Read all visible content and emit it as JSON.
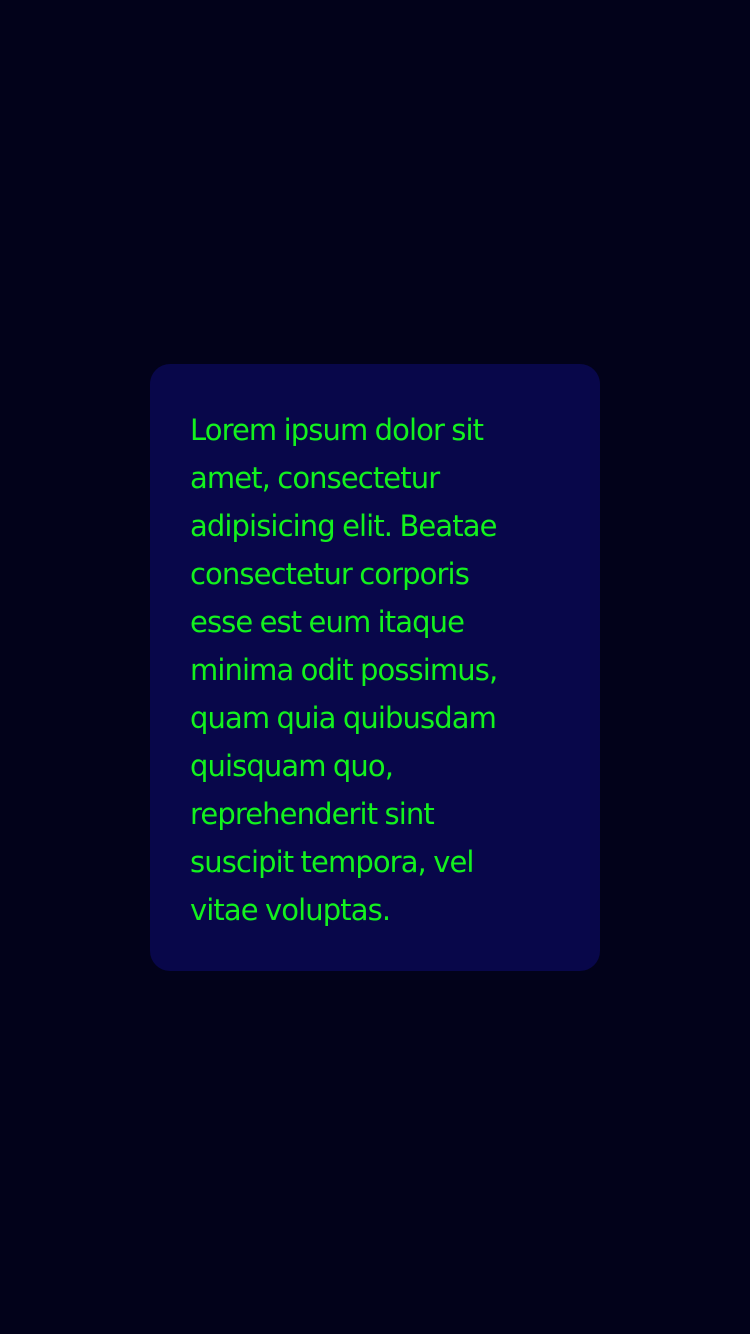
{
  "card": {
    "text": "Lorem ipsum dolor sit\namet, consectetur\nadipisicing elit. Beatae\nconsectetur corporis\nesse est eum itaque\nminima odit possimus,\nquam quia quibusdam\nquisquam quo,\nreprehenderit sint\nsuscipit tempora, vel\nvitae voluptas."
  },
  "colors": {
    "background": "#02021a",
    "card_background": "#08074a",
    "text": "#13f21e"
  }
}
